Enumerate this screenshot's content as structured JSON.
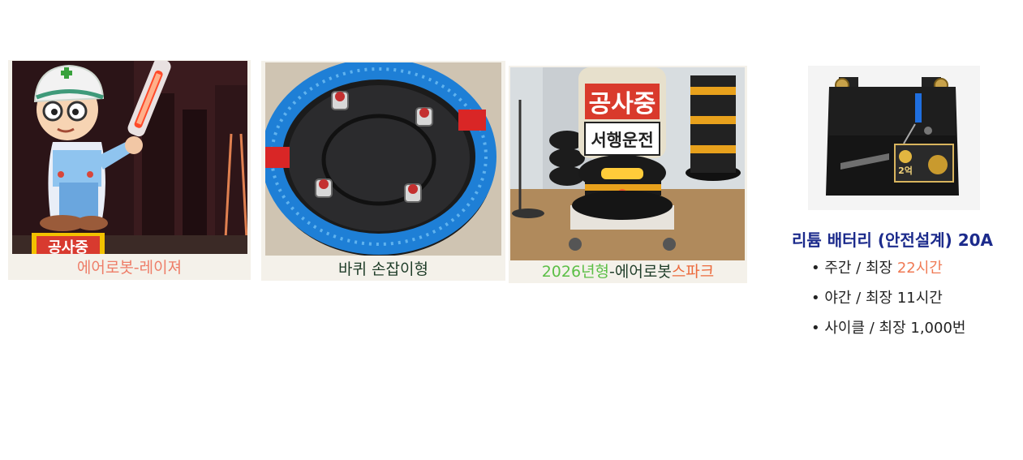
{
  "products": [
    {
      "caption_parts": [
        {
          "text": "에어로봇-레이져",
          "color": "#ee7d68"
        }
      ],
      "photo_text": [
        "공사중"
      ]
    },
    {
      "caption_parts": [
        {
          "text": "바퀴 손잡이형",
          "color": "#1f3d29"
        }
      ],
      "photo_text": []
    },
    {
      "caption_parts": [
        {
          "text": "2026년형",
          "color": "#5cbf47"
        },
        {
          "text": "-에어로봇",
          "color": "#1f3d29"
        },
        {
          "text": "스파크",
          "color": "#ec6a3c"
        }
      ],
      "photo_text": [
        "공사중",
        "서행운전"
      ]
    }
  ],
  "battery": {
    "title": "리튬 배터리 (안전설계) 20A",
    "title_color": "#1c2b8c",
    "badge_text": "2억",
    "specs": [
      {
        "label": "주간 / 최장 ",
        "value": "22시간",
        "value_color": "#f07a55"
      },
      {
        "label": "야간 / 최장 ",
        "value": "11시간",
        "value_color": "#222222"
      },
      {
        "label": "사이클 / 최장 ",
        "value": "1,000번",
        "value_color": "#222222"
      }
    ]
  }
}
